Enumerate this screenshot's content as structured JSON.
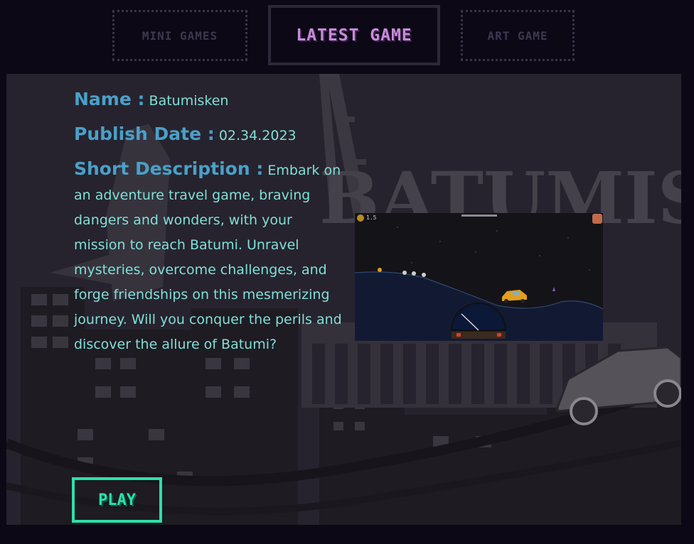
{
  "tabs": [
    {
      "label": "MINI GAMES",
      "active": false
    },
    {
      "label": "LATEST GAME",
      "active": true
    },
    {
      "label": "ART GAME",
      "active": false
    }
  ],
  "game": {
    "name_label": "Name :",
    "name": "Batumisken",
    "date_label": "Publish Date :",
    "date": "02.34.2023",
    "desc_label": "Short Description :",
    "description": "Embark on an adventure travel game, braving dangers and wonders, with your mission to reach Batumi. Unravel mysteries, overcome challenges, and forge friendships on this mesmerizing journey. Will you conquer the perils and discover the allure of Batumi?",
    "background_title": "BATUMISK",
    "screenshot_hud_value": "1.5"
  },
  "play_button": {
    "label": "PLAY"
  },
  "colors": {
    "page_bg": "#0c0816",
    "active_tab_text": "#c58bd8",
    "label_blue": "#4aa0c8",
    "body_text": "#7fe0d8",
    "play_accent": "#2de0a8"
  }
}
